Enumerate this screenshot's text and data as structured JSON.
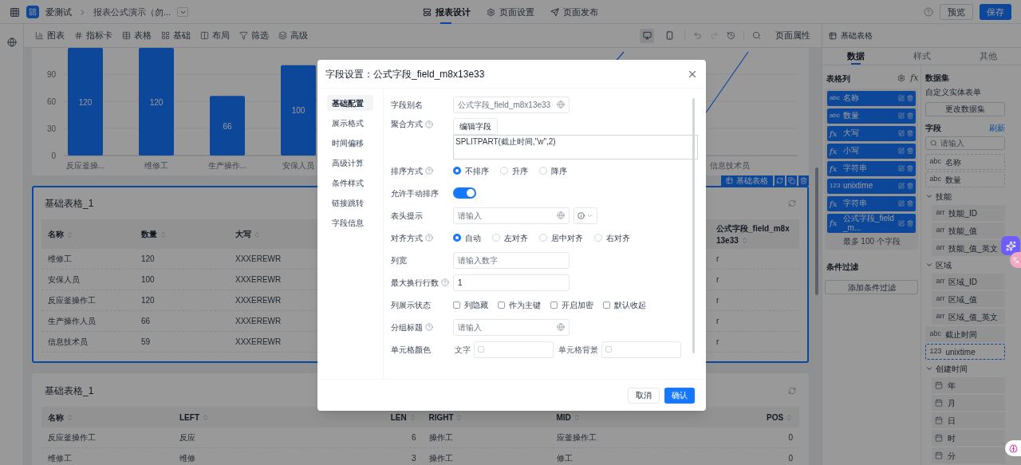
{
  "app": {
    "name": "爱测试",
    "breadcrumb": "报表公式演示（勿...",
    "page_tabs": [
      {
        "label": "报表设计",
        "selected": true
      },
      {
        "label": "页面设置",
        "selected": false
      },
      {
        "label": "页面发布",
        "selected": false
      }
    ],
    "buttons": [
      {
        "label": "预览",
        "kind": "default"
      },
      {
        "label": "保存",
        "kind": "primary"
      }
    ]
  },
  "toolbar": {
    "items": [
      "图表",
      "指标卡",
      "表格",
      "基础",
      "布局",
      "筛选",
      "高级"
    ],
    "devices": [
      {
        "selected": true
      },
      {
        "selected": false
      }
    ],
    "page_props": "页面属性"
  },
  "chart": {
    "chart_data": {
      "type": "bar",
      "categories": [
        "反应釜操...",
        "维修工",
        "生产操作...",
        "安保人员"
      ],
      "values": [
        120,
        120,
        66,
        100
      ],
      "ylim": [
        0,
        120
      ],
      "grid": true,
      "yticks": [
        0,
        30,
        60,
        90
      ],
      "data_labels": true
    },
    "line_chart_label": "信息技术员"
  },
  "tables": [
    {
      "title": "基础表格_1",
      "selected": true,
      "tag": "基础表格",
      "columns": [
        {
          "label": "名称",
          "right_aligned": false
        },
        {
          "label": "数量",
          "right_aligned": false
        },
        {
          "label": "大写",
          "right_aligned": false
        },
        {
          "label": "公式字段_field_m8x13e33",
          "right_aligned": false
        }
      ],
      "rows": [
        [
          "维修工",
          "120",
          "XXXEREWR",
          "r"
        ],
        [
          "安保人员",
          "100",
          "XXXEREWR",
          "r"
        ],
        [
          "反应釜操作工",
          "120",
          "XXXEREWR",
          "r"
        ],
        [
          "生产操作人员",
          "66",
          "XXXEREWR",
          "r"
        ],
        [
          "信息技术员",
          "59",
          "XXXEREWR",
          "r"
        ]
      ]
    },
    {
      "title": "基础表格_1",
      "selected": false,
      "columns": [
        {
          "label": "名称",
          "right_aligned": false
        },
        {
          "label": "LEFT",
          "right_aligned": false
        },
        {
          "label": "LEN",
          "right_aligned": true
        },
        {
          "label": "RIGHT",
          "right_aligned": false
        },
        {
          "label": "MID",
          "right_aligned": false
        },
        {
          "label": "POS",
          "right_aligned": true
        }
      ],
      "rows": [
        [
          "反应釜操作工",
          "反应",
          "6",
          "操作工",
          "应釜操作工",
          "0"
        ],
        [
          "维修工",
          "维修",
          "3",
          "操作工",
          "修工",
          "0"
        ]
      ]
    }
  ],
  "right_panel": {
    "header": "基础表格",
    "tabs": [
      {
        "label": "数据",
        "selected": true
      },
      {
        "label": "样式",
        "selected": false
      },
      {
        "label": "其他",
        "selected": false
      }
    ],
    "columns_title": "表格列",
    "formula_button": "fx",
    "columns": [
      {
        "kind": "text",
        "type": "abc",
        "label": "名称"
      },
      {
        "kind": "text",
        "type": "abc",
        "label": "数量"
      },
      {
        "kind": "formula",
        "type": "fx",
        "label": "大写"
      },
      {
        "kind": "formula",
        "type": "fx",
        "label": "小写"
      },
      {
        "kind": "formula",
        "type": "fx",
        "label": "字符串"
      },
      {
        "kind": "text",
        "type": "123",
        "label": "unixtime"
      },
      {
        "kind": "formula",
        "type": "fx",
        "label": "字符串"
      },
      {
        "kind": "formula",
        "type": "fx",
        "label": "公式字段_field_m..."
      }
    ],
    "columns_note": "最多 100 个字段",
    "filter_title": "条件过滤",
    "filter_button": "添加条件过滤",
    "dataset_title": "数据集",
    "dataset_name": "自定义实体表单",
    "dataset_button": "更改数据集",
    "fields_title": "字段",
    "refresh": "刷新",
    "search_placeholder": "请输入",
    "fields": [
      {
        "kind": "field",
        "type": "abc",
        "label": "名称",
        "dimmed": true,
        "selected": false
      },
      {
        "kind": "field",
        "type": "abc",
        "label": "数量",
        "dimmed": true,
        "selected": false
      },
      {
        "kind": "group",
        "label": "技能",
        "expanded": true,
        "children": [
          {
            "kind": "field",
            "type": "arr",
            "label": "技能_ID",
            "dimmed": false,
            "selected": false
          },
          {
            "kind": "field",
            "type": "arr",
            "label": "技能_值",
            "dimmed": false,
            "selected": false
          },
          {
            "kind": "field",
            "type": "arr",
            "label": "技能_值_英文",
            "dimmed": false,
            "selected": false
          }
        ]
      },
      {
        "kind": "group",
        "label": "区域",
        "expanded": true,
        "children": [
          {
            "kind": "field",
            "type": "arr",
            "label": "区域_ID",
            "dimmed": false,
            "selected": false
          },
          {
            "kind": "field",
            "type": "arr",
            "label": "区域_值",
            "dimmed": false,
            "selected": false
          },
          {
            "kind": "field",
            "type": "arr",
            "label": "区域_值_英文",
            "dimmed": false,
            "selected": false
          }
        ]
      },
      {
        "kind": "field",
        "type": "abc",
        "label": "截止时间",
        "dimmed": false,
        "selected": false
      },
      {
        "kind": "field",
        "type": "123",
        "label": "unixtime",
        "dimmed": true,
        "selected": true
      },
      {
        "kind": "group",
        "label": "创建时间",
        "expanded": true,
        "children": [
          {
            "kind": "date",
            "label": "年"
          },
          {
            "kind": "date",
            "label": "月"
          },
          {
            "kind": "date",
            "label": "日"
          },
          {
            "kind": "date",
            "label": "时"
          },
          {
            "kind": "date",
            "label": "分"
          }
        ]
      }
    ]
  },
  "dialog": {
    "title": "字段设置：公式字段_field_m8x13e33",
    "nav": [
      {
        "label": "基础配置",
        "selected": true
      },
      {
        "label": "展示格式",
        "selected": false
      },
      {
        "label": "时间偏移",
        "selected": false
      },
      {
        "label": "高级计算",
        "selected": false
      },
      {
        "label": "条件样式",
        "selected": false
      },
      {
        "label": "链接跳转",
        "selected": false
      },
      {
        "label": "字段信息",
        "selected": false
      }
    ],
    "rows": [
      {
        "kind": "input",
        "label": "字段别名",
        "help": false,
        "placeholder": "公式字段_field_m8x13e33",
        "globe": true
      },
      {
        "kind": "formula",
        "label": "聚合方式",
        "help": true,
        "button": "编辑字段",
        "value": "SPLITPART(截止时间,\"w\",2)"
      },
      {
        "kind": "radio",
        "label": "排序方式",
        "help": true,
        "options": [
          {
            "label": "不排序",
            "selected": true
          },
          {
            "label": "升序",
            "selected": false
          },
          {
            "label": "降序",
            "selected": false
          }
        ]
      },
      {
        "kind": "switch",
        "label": "允许手动排序",
        "help": false,
        "on": true
      },
      {
        "kind": "input_select",
        "label": "表头提示",
        "help": false,
        "placeholder": "请输入",
        "globe": true
      },
      {
        "kind": "radio",
        "label": "对齐方式",
        "help": true,
        "options": [
          {
            "label": "自动",
            "selected": true
          },
          {
            "label": "左对齐",
            "selected": false
          },
          {
            "label": "居中对齐",
            "selected": false
          },
          {
            "label": "右对齐",
            "selected": false
          }
        ]
      },
      {
        "kind": "input",
        "label": "列宽",
        "help": false,
        "placeholder": "请输入数字",
        "globe": false
      },
      {
        "kind": "input",
        "label": "最大换行行数",
        "help": true,
        "value": "1",
        "globe": false
      },
      {
        "kind": "checkbox",
        "label": "列展示状态",
        "help": false,
        "options": [
          {
            "label": "列隐藏",
            "checked": false
          },
          {
            "label": "作为主键",
            "checked": false
          },
          {
            "label": "开启加密",
            "checked": false
          },
          {
            "label": "默认收起",
            "checked": false
          }
        ]
      },
      {
        "kind": "input",
        "label": "分组标题",
        "help": true,
        "placeholder": "请输入",
        "globe": true
      },
      {
        "kind": "color",
        "label": "单元格颜色",
        "help": false,
        "fields": [
          "文字",
          "单元格背景"
        ]
      }
    ],
    "buttons": [
      {
        "label": "取消",
        "kind": "default"
      },
      {
        "label": "确认",
        "kind": "primary"
      }
    ]
  }
}
